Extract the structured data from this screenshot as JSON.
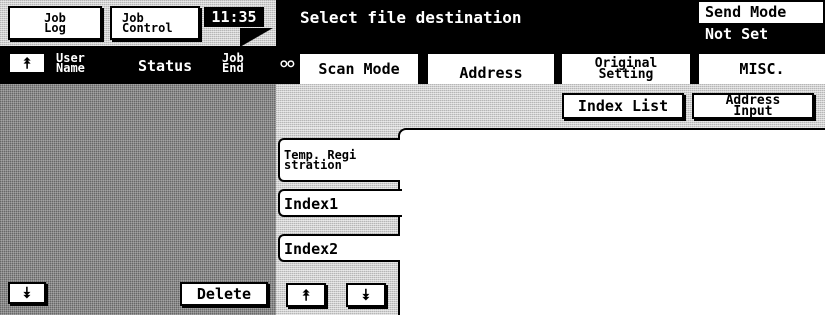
{
  "top": {
    "job_log_label": [
      "Job",
      "Log"
    ],
    "job_control_label": [
      "Job",
      "Control"
    ],
    "clock": "11:35",
    "title": "Select file destination",
    "send_mode_label": "Send Mode",
    "send_mode_value": "Not Set"
  },
  "job_list": {
    "scroll_up_icon": "double-up-arrow",
    "col_user_name": [
      "User",
      "Name"
    ],
    "col_status": "Status",
    "col_job_end": [
      "Job",
      "End"
    ],
    "scroll_down_icon": "double-down-arrow",
    "delete_label": "Delete"
  },
  "tabs": {
    "scan_mode": "Scan Mode",
    "address": "Address",
    "original_setting": [
      "Original",
      "Setting"
    ],
    "misc": "MISC."
  },
  "address_panel": {
    "index_list_label": "Index List",
    "address_input_label": [
      "Address",
      "Input"
    ],
    "side_tabs": [
      [
        "Temp. Regi",
        "stration"
      ],
      [
        "Index1"
      ],
      [
        "Index2"
      ]
    ],
    "page_up_icon": "double-up-arrow",
    "page_down_icon": "double-down-arrow"
  }
}
